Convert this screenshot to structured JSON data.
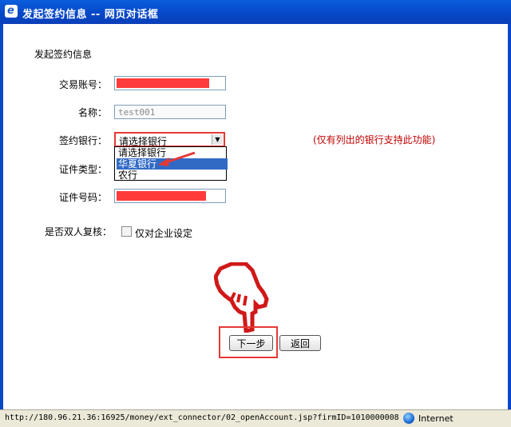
{
  "window": {
    "title": "发起签约信息 -- 网页对话框"
  },
  "form": {
    "section_title": "发起签约信息",
    "fields": {
      "account_label": "交易账号：",
      "name_label": "名称：",
      "name_value": "test001",
      "bank_label": "签约银行：",
      "id_type_label": "证件类型：",
      "id_number_label": "证件号码："
    },
    "bank_select": {
      "selected": "请选择银行",
      "options": [
        "请选择银行",
        "华夏银行",
        "农行"
      ],
      "highlighted_index": 1
    },
    "hint": "(仅有列出的银行支持此功能)",
    "dual_review_label": "是否双人复核：",
    "dual_review_checkbox_label": "仅对企业设定"
  },
  "buttons": {
    "next": "下一步",
    "back": "返回"
  },
  "statusbar": {
    "url": "http://180.96.21.36:16925/money/ext_connector/02_openAccount.jsp?firmID=1010000008",
    "zone": "Internet"
  },
  "colors": {
    "titlebar": "#0648c8",
    "annotation_red": "#e53935",
    "hint_red": "#c00000",
    "redaction": "#ff3b3b"
  }
}
